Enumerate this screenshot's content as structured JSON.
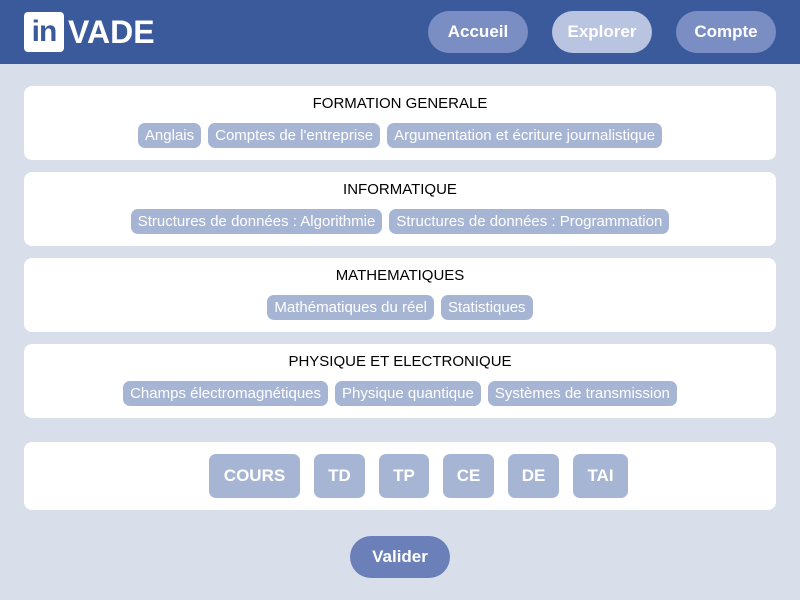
{
  "header": {
    "logo_mark": "in",
    "logo_text": "VADE",
    "nav": {
      "accueil": "Accueil",
      "explorer": "Explorer",
      "compte": "Compte"
    }
  },
  "categories": [
    {
      "title": "FORMATION GENERALE",
      "tags": [
        "Anglais",
        "Comptes de l'entreprise",
        "Argumentation et écriture journalistique"
      ]
    },
    {
      "title": "INFORMATIQUE",
      "tags": [
        "Structures de données : Algorithmie",
        "Structures de données : Programmation"
      ]
    },
    {
      "title": "MATHEMATIQUES",
      "tags": [
        "Mathématiques du réel",
        "Statistiques"
      ]
    },
    {
      "title": "PHYSIQUE ET ELECTRONIQUE",
      "tags": [
        "Champs électromagnétiques",
        "Physique quantique",
        "Systèmes de transmission"
      ]
    }
  ],
  "types": [
    "COURS",
    "TD",
    "TP",
    "CE",
    "DE",
    "TAI"
  ],
  "validate_label": "Valider",
  "colors": {
    "header_bg": "#3b5a9b",
    "tag_bg": "#a7b5d4",
    "page_bg": "#d8deea",
    "validate_bg": "#6b80b8"
  }
}
